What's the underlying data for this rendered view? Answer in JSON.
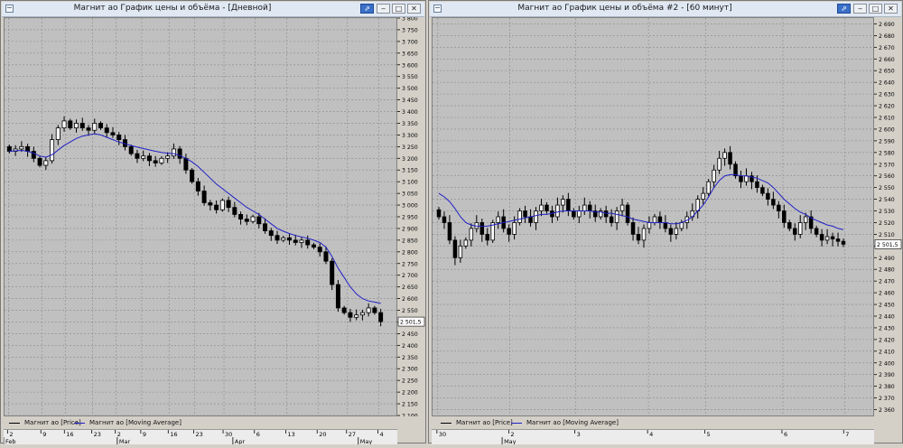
{
  "windows": [
    {
      "title": "Магнит ао График цены и объёма - [Дневной]",
      "buttons": {
        "pin": "⇗",
        "minimize": "‒",
        "maximize": "□",
        "close": "✕"
      },
      "legend": [
        {
          "label": "Магнит ао [Price]",
          "color": "#000000"
        },
        {
          "label": "Магнит ао [Moving Average]",
          "color": "#1f1fc8"
        }
      ],
      "last_price_label": "2 501,5",
      "x_ticks": [
        "2",
        "9",
        "16",
        "23",
        "2",
        "9",
        "16",
        "23",
        "30",
        "6",
        "13",
        "20",
        "27",
        "4"
      ],
      "x_months": [
        "Feb",
        "Mar",
        "Apr",
        "May"
      ]
    },
    {
      "title": "Магнит ао График цены и объёма #2 - [60 минут]",
      "buttons": {
        "pin": "⇗",
        "minimize": "‒",
        "maximize": "□",
        "close": "✕"
      },
      "legend": [
        {
          "label": "Магнит ао [Price]",
          "color": "#000000"
        },
        {
          "label": "Магнит ао [Moving Average]",
          "color": "#1f1fc8"
        }
      ],
      "last_price_label": "2 501,5",
      "x_ticks": [
        "30",
        "2",
        "3",
        "4",
        "5",
        "6",
        "7"
      ],
      "x_months": [
        "May"
      ]
    }
  ],
  "chart_data": [
    {
      "type": "candlestick",
      "title": "Магнит ао График цены и объёма - [Дневной]",
      "ylim": [
        2100,
        3800
      ],
      "ytick_step": 50,
      "grid": true,
      "x_categories": [
        "2",
        "9",
        "16",
        "23",
        "2",
        "9",
        "16",
        "23",
        "30",
        "6",
        "13",
        "20",
        "27",
        "4"
      ],
      "series": [
        {
          "name": "Магнит ао [Price]",
          "kind": "candlestick",
          "close": [
            3230,
            3240,
            3250,
            3230,
            3200,
            3170,
            3190,
            3280,
            3330,
            3360,
            3330,
            3350,
            3330,
            3320,
            3350,
            3330,
            3310,
            3300,
            3280,
            3250,
            3220,
            3200,
            3210,
            3190,
            3180,
            3200,
            3210,
            3240,
            3200,
            3150,
            3100,
            3060,
            3010,
            3000,
            2980,
            3020,
            2990,
            2960,
            2940,
            2930,
            2950,
            2920,
            2890,
            2870,
            2850,
            2860,
            2850,
            2840,
            2850,
            2830,
            2820,
            2800,
            2760,
            2660,
            2560,
            2540,
            2520,
            2530,
            2540,
            2560,
            2540,
            2501.5
          ]
        },
        {
          "name": "Магнит ао [Moving Average]",
          "kind": "line",
          "values": [
            3230,
            3232,
            3234,
            3230,
            3222,
            3210,
            3205,
            3215,
            3235,
            3255,
            3270,
            3285,
            3295,
            3300,
            3305,
            3300,
            3290,
            3280,
            3270,
            3262,
            3255,
            3248,
            3242,
            3236,
            3230,
            3225,
            3222,
            3220,
            3212,
            3200,
            3185,
            3165,
            3140,
            3115,
            3090,
            3070,
            3050,
            3030,
            3010,
            2990,
            2975,
            2960,
            2940,
            2920,
            2900,
            2888,
            2878,
            2870,
            2864,
            2858,
            2850,
            2840,
            2820,
            2780,
            2730,
            2690,
            2650,
            2620,
            2600,
            2590,
            2585,
            2580
          ]
        }
      ]
    },
    {
      "type": "candlestick",
      "title": "Магнит ао График цены и объёма #2 - [60 минут]",
      "ylim": [
        2355,
        2695
      ],
      "ytick_step": 10,
      "grid": true,
      "x_categories": [
        "30",
        "2",
        "3",
        "4",
        "5",
        "6",
        "7"
      ],
      "series": [
        {
          "name": "Магнит ао [Price]",
          "kind": "candlestick",
          "close": [
            2525,
            2520,
            2505,
            2490,
            2500,
            2505,
            2515,
            2520,
            2510,
            2505,
            2520,
            2525,
            2515,
            2510,
            2520,
            2530,
            2525,
            2520,
            2530,
            2535,
            2530,
            2525,
            2535,
            2540,
            2530,
            2525,
            2530,
            2535,
            2530,
            2525,
            2530,
            2525,
            2520,
            2530,
            2535,
            2520,
            2510,
            2505,
            2515,
            2520,
            2525,
            2520,
            2515,
            2510,
            2515,
            2520,
            2525,
            2530,
            2540,
            2545,
            2555,
            2565,
            2575,
            2580,
            2570,
            2560,
            2555,
            2560,
            2555,
            2550,
            2545,
            2540,
            2535,
            2530,
            2520,
            2515,
            2510,
            2520,
            2525,
            2515,
            2510,
            2505,
            2508,
            2506,
            2504,
            2501.5
          ]
        },
        {
          "name": "Магнит ао [Moving Average]",
          "kind": "line",
          "values": [
            2545,
            2542,
            2538,
            2532,
            2525,
            2520,
            2518,
            2517,
            2517,
            2517,
            2518,
            2519,
            2520,
            2521,
            2522,
            2523,
            2524,
            2525,
            2526,
            2527,
            2527,
            2528,
            2529,
            2530,
            2530,
            2530,
            2530,
            2530,
            2530,
            2529,
            2529,
            2528,
            2528,
            2527,
            2526,
            2525,
            2523,
            2522,
            2521,
            2520,
            2520,
            2520,
            2520,
            2519,
            2519,
            2520,
            2522,
            2525,
            2530,
            2535,
            2542,
            2550,
            2556,
            2560,
            2561,
            2561,
            2560,
            2560,
            2559,
            2558,
            2556,
            2554,
            2550,
            2545,
            2540,
            2536,
            2532,
            2529,
            2527,
            2524,
            2522,
            2520,
            2518,
            2517,
            2515,
            2514
          ]
        }
      ]
    }
  ]
}
